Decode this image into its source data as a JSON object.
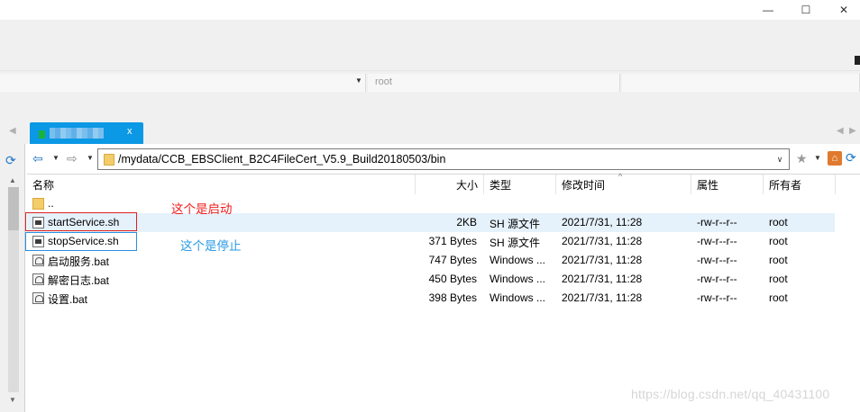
{
  "window": {
    "minimize_glyph": "—",
    "maximize_glyph": "☐",
    "close_glyph": "✕"
  },
  "session": {
    "user_placeholder": "root"
  },
  "tab": {
    "close_glyph": "x"
  },
  "path": {
    "value": "/mydata/CCB_EBSClient_B2C4FileCert_V5.9_Build20180503/bin"
  },
  "columns": {
    "name": "名称",
    "size": "大小",
    "type": "类型",
    "modified": "修改时间",
    "attributes": "属性",
    "owner": "所有者"
  },
  "files": [
    {
      "icon": "folder-icon",
      "name": "..",
      "size": "",
      "type": "",
      "modified": "",
      "attributes": "",
      "owner": ""
    },
    {
      "icon": "shell-script-icon",
      "name": "startService.sh",
      "size": "2KB",
      "type": "SH 源文件",
      "modified": "2021/7/31, 11:28",
      "attributes": "-rw-r--r--",
      "owner": "root"
    },
    {
      "icon": "shell-script-icon",
      "name": "stopService.sh",
      "size": "371 Bytes",
      "type": "SH 源文件",
      "modified": "2021/7/31, 11:28",
      "attributes": "-rw-r--r--",
      "owner": "root"
    },
    {
      "icon": "batch-file-icon",
      "name": "启动服务.bat",
      "size": "747 Bytes",
      "type": "Windows ...",
      "modified": "2021/7/31, 11:28",
      "attributes": "-rw-r--r--",
      "owner": "root"
    },
    {
      "icon": "batch-file-icon",
      "name": "解密日志.bat",
      "size": "450 Bytes",
      "type": "Windows ...",
      "modified": "2021/7/31, 11:28",
      "attributes": "-rw-r--r--",
      "owner": "root"
    },
    {
      "icon": "batch-file-icon",
      "name": "设置.bat",
      "size": "398 Bytes",
      "type": "Windows ...",
      "modified": "2021/7/31, 11:28",
      "attributes": "-rw-r--r--",
      "owner": "root"
    }
  ],
  "annotations": {
    "start": "这个是启动",
    "stop": "这个是停止",
    "start_color": "#f01e1e",
    "stop_color": "#2a9be6"
  },
  "watermark": "https://blog.csdn.net/qq_40431100",
  "colors": {
    "tab_active": "#0b98e4",
    "selection": "#e5f1fb"
  }
}
